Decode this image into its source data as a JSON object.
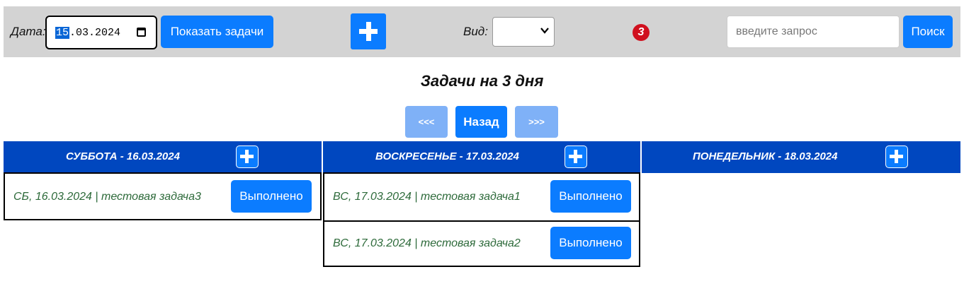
{
  "toolbar": {
    "date_label": "Дата:",
    "date_day": "15",
    "date_rest": ".03.2024",
    "show_tasks_label": "Показать задачи",
    "view_label": "Вид:",
    "view_value": "",
    "badge_count": "3",
    "search_placeholder": "введите запрос",
    "search_label": "Поиск"
  },
  "main": {
    "title": "Задачи на 3 дня",
    "nav": {
      "prev": "<<<",
      "back": "Назад",
      "next": ">>>"
    }
  },
  "days": [
    {
      "header": "СУББОТА - 16.03.2024",
      "tasks": [
        {
          "text": "СБ, 16.03.2024 | тестовая задача3",
          "button": "Выполнено"
        }
      ]
    },
    {
      "header": "ВОСКРЕСЕНЬЕ - 17.03.2024",
      "tasks": [
        {
          "text": "ВС, 17.03.2024 | тестовая задача1",
          "button": "Выполнено"
        },
        {
          "text": "ВС, 17.03.2024 | тестовая задача2",
          "button": "Выполнено"
        }
      ]
    },
    {
      "header": "ПОНЕДЕЛЬНИК - 18.03.2024",
      "tasks": []
    }
  ],
  "colors": {
    "toolbar_bg": "#d3d3d3",
    "primary": "#0b7cff",
    "primary_disabled": "#7fb1f7",
    "day_header": "#0047bf",
    "badge": "#d0101e",
    "task_text": "#2d6a3a"
  },
  "icons": {
    "add_big": "plus-icon",
    "add_day": "plus-icon",
    "calendar": "calendar-icon",
    "select": "chevron-down-icon"
  }
}
